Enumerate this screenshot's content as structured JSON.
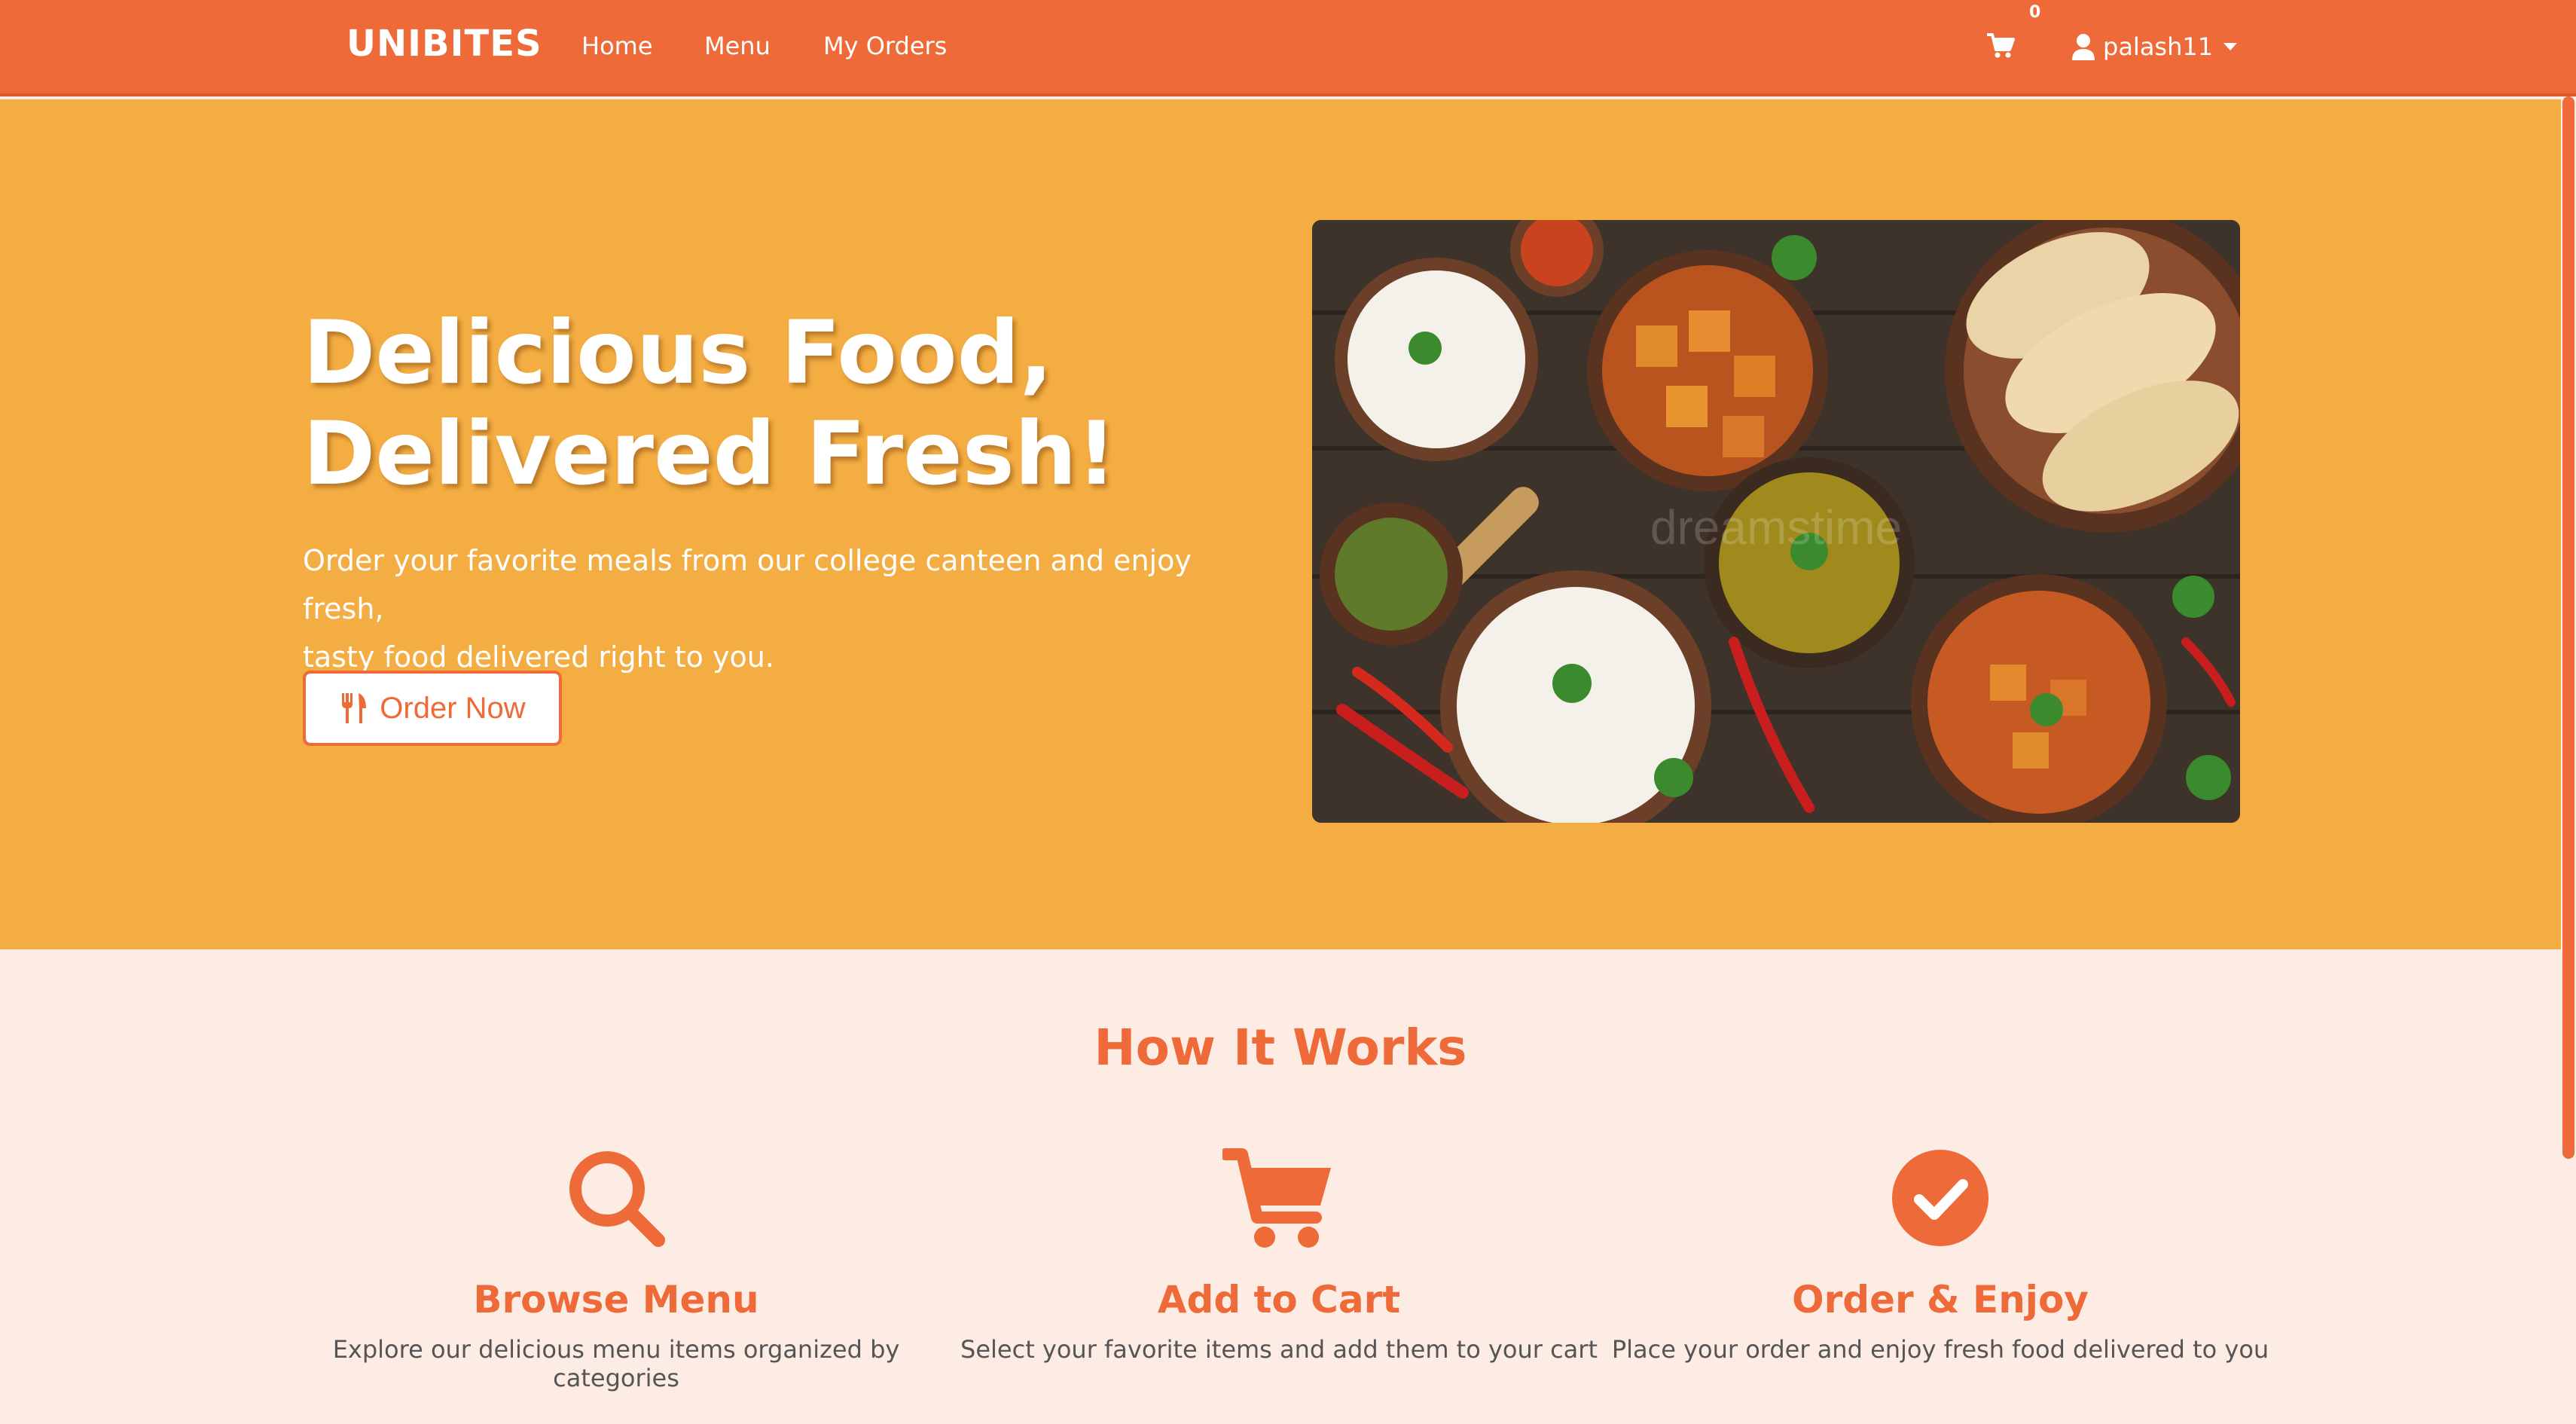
{
  "nav": {
    "brand": "UNIBITES",
    "links": [
      "Home",
      "Menu",
      "My Orders"
    ],
    "cart_count": "0",
    "user_name": "palash11"
  },
  "hero": {
    "title_line1": "Delicious Food,",
    "title_line2": "Delivered Fresh!",
    "subtitle_line1": "Order your favorite meals from our college canteen and enjoy fresh,",
    "subtitle_line2": "tasty food delivered right to you.",
    "cta_label": "Order Now",
    "cta_icon": "utensils-icon",
    "image_watermark": "dreamstime"
  },
  "how": {
    "title": "How It Works",
    "steps": [
      {
        "icon": "search-icon",
        "title": "Browse Menu",
        "desc": "Explore our delicious menu items organized by categories"
      },
      {
        "icon": "cart-icon",
        "title": "Add to Cart",
        "desc": "Select your favorite items and add them to your cart"
      },
      {
        "icon": "check-circle-icon",
        "title": "Order & Enjoy",
        "desc": "Place your order and enjoy fresh food delivered to you"
      }
    ]
  },
  "colors": {
    "primary": "#ee6a38",
    "hero_bg": "#f3ad42",
    "page_bg": "#fcece4",
    "text_muted": "#555555"
  }
}
